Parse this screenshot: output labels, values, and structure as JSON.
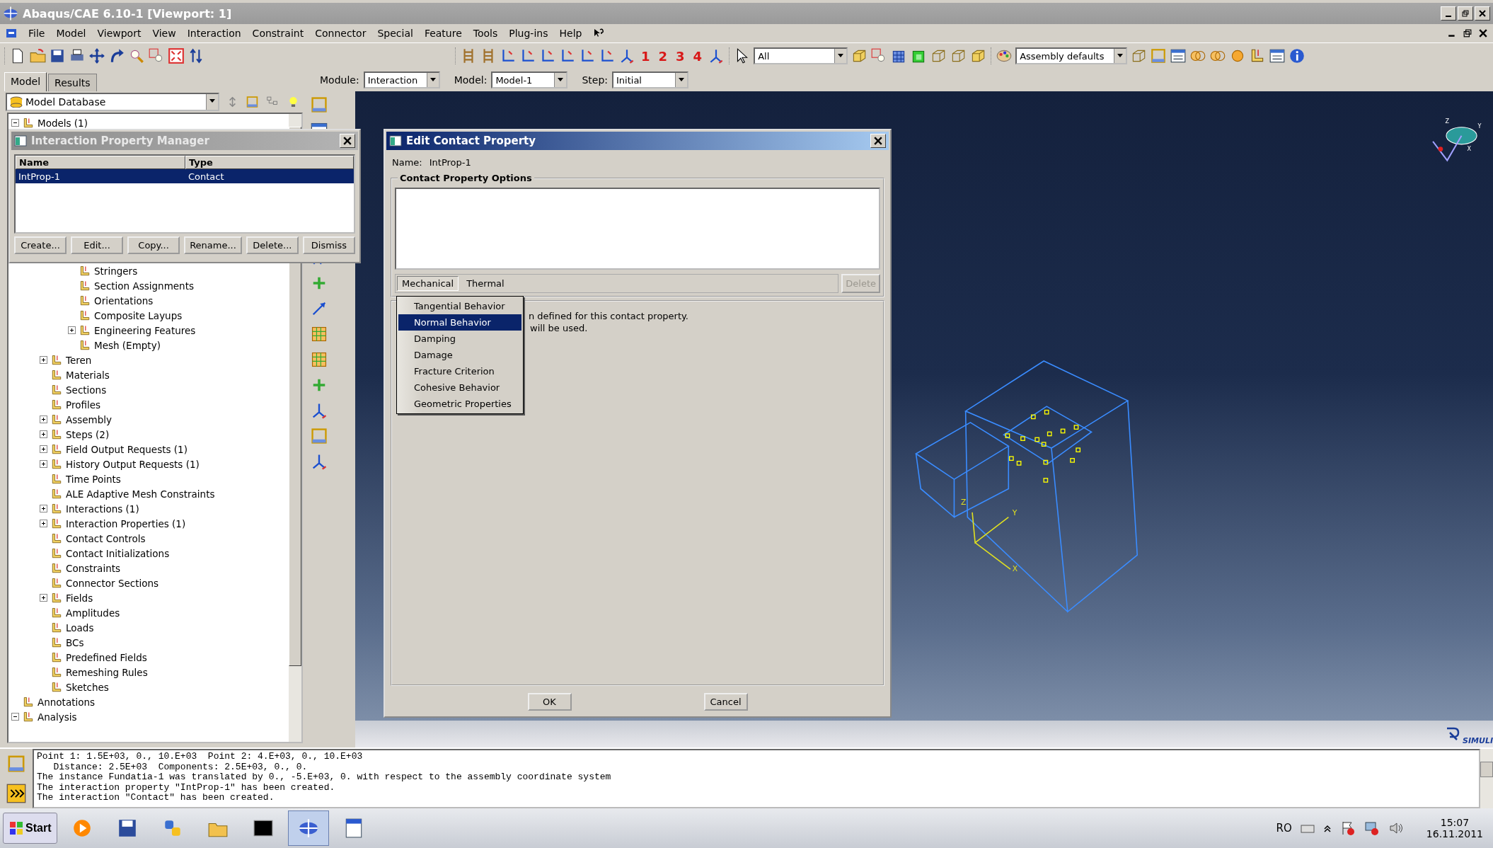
{
  "window": {
    "title": "Abaqus/CAE 6.10-1 [Viewport: 1]"
  },
  "menu_bar": [
    "File",
    "Model",
    "Viewport",
    "View",
    "Interaction",
    "Constraint",
    "Connector",
    "Special",
    "Feature",
    "Tools",
    "Plug-ins",
    "Help"
  ],
  "toolbar": {
    "view_numbers": [
      "1",
      "2",
      "3",
      "4"
    ],
    "selection_filter": "All",
    "display_group": "Assembly defaults"
  },
  "tabs": [
    {
      "label": "Model",
      "selected": true
    },
    {
      "label": "Results",
      "selected": false
    }
  ],
  "context_bar": [
    {
      "label": "Module:",
      "value": "Interaction"
    },
    {
      "label": "Model:",
      "value": "Model-1"
    },
    {
      "label": "Step:",
      "value": "Initial"
    }
  ],
  "model_tree": {
    "source": "Model Database",
    "root": {
      "label": "Models (1)",
      "expanded": true
    },
    "part_items": [
      {
        "label": "Stringers"
      },
      {
        "label": "Section Assignments"
      },
      {
        "label": "Orientations"
      },
      {
        "label": "Composite Layups"
      },
      {
        "label": "Engineering Features",
        "expanded": false
      },
      {
        "label": "Mesh (Empty)"
      }
    ],
    "model_items": [
      {
        "label": "Teren",
        "expanded": false
      },
      {
        "label": "Materials"
      },
      {
        "label": "Sections"
      },
      {
        "label": "Profiles"
      },
      {
        "label": "Assembly",
        "expanded": false
      },
      {
        "label": "Steps (2)",
        "expanded": false
      },
      {
        "label": "Field Output Requests (1)",
        "expanded": false
      },
      {
        "label": "History Output Requests (1)",
        "expanded": false
      },
      {
        "label": "Time Points"
      },
      {
        "label": "ALE Adaptive Mesh Constraints"
      },
      {
        "label": "Interactions (1)",
        "expanded": false
      },
      {
        "label": "Interaction Properties (1)",
        "expanded": false
      },
      {
        "label": "Contact Controls"
      },
      {
        "label": "Contact Initializations"
      },
      {
        "label": "Constraints"
      },
      {
        "label": "Connector Sections"
      },
      {
        "label": "Fields",
        "expanded": false
      },
      {
        "label": "Amplitudes"
      },
      {
        "label": "Loads"
      },
      {
        "label": "BCs"
      },
      {
        "label": "Predefined Fields"
      },
      {
        "label": "Remeshing Rules"
      },
      {
        "label": "Sketches"
      }
    ],
    "top_items": [
      {
        "label": "Annotations"
      },
      {
        "label": "Analysis",
        "expanded": true
      }
    ]
  },
  "property_manager": {
    "title": "Interaction Property Manager",
    "columns": [
      "Name",
      "Type"
    ],
    "rows": [
      {
        "name": "IntProp-1",
        "type": "Contact",
        "selected": true
      }
    ],
    "buttons": [
      "Create...",
      "Edit...",
      "Copy...",
      "Rename...",
      "Delete...",
      "Dismiss"
    ]
  },
  "edit_dialog": {
    "title": "Edit Contact Property",
    "name_label": "Name:",
    "name_value": "IntProp-1",
    "group_title": "Contact Property Options",
    "menus": [
      {
        "label": "Mechanical",
        "selected": true
      },
      {
        "label": "Thermal",
        "selected": false
      }
    ],
    "delete_button": {
      "label": "Delete",
      "disabled": true
    },
    "message_lines": [
      "n defined for this contact property.",
      "will be used."
    ],
    "menu_items": [
      {
        "label": "Tangential Behavior",
        "selected": false
      },
      {
        "label": "Normal Behavior",
        "selected": true
      },
      {
        "label": "Damping",
        "selected": false
      },
      {
        "label": "Damage",
        "selected": false
      },
      {
        "label": "Fracture Criterion",
        "selected": false
      },
      {
        "label": "Cohesive Behavior",
        "selected": false
      },
      {
        "label": "Geometric Properties",
        "selected": false
      }
    ],
    "ok": "OK",
    "cancel": "Cancel"
  },
  "viewport": {
    "axis_labels": [
      "Z",
      "Y",
      "X"
    ],
    "triad_labels": [
      "Z",
      "Y",
      "X"
    ],
    "logo": "SIMULI"
  },
  "message_area": {
    "lines": [
      "Point 1: 1.5E+03, 0., 10.E+03  Point 2: 4.E+03, 0., 10.E+03",
      "   Distance: 2.5E+03  Components: 2.5E+03, 0., 0.",
      "The instance Fundatia-1 was translated by 0., -5.E+03, 0. with respect to the assembly coordinate system",
      "The interaction property \"IntProp-1\" has been created.",
      "The interaction \"Contact\" has been created."
    ]
  },
  "taskbar": {
    "start": "Start",
    "apps": [
      {
        "kind": "media",
        "selected": false
      },
      {
        "kind": "save",
        "selected": false
      },
      {
        "kind": "python",
        "selected": false
      },
      {
        "kind": "folder",
        "selected": false
      },
      {
        "kind": "console",
        "selected": false
      },
      {
        "kind": "abaqus",
        "selected": true
      },
      {
        "kind": "cdf",
        "selected": false
      }
    ],
    "language": "RO",
    "time": "15:07",
    "date": "16.11.2011"
  }
}
